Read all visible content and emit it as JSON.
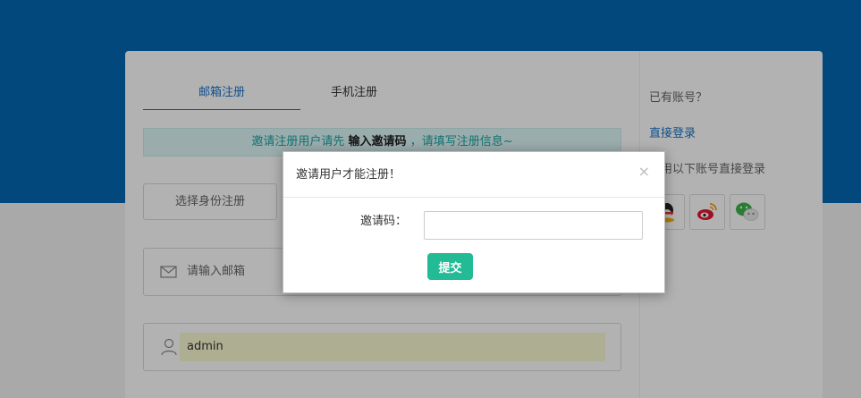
{
  "tabs": [
    {
      "label": "邮箱注册",
      "active": true
    },
    {
      "label": "手机注册",
      "active": false
    }
  ],
  "notice": {
    "prefix": "邀请注册用户请先",
    "highlight": "输入邀请码",
    "suffix": "，请填写注册信息~"
  },
  "form": {
    "identity_placeholder": "选择身份注册",
    "email_placeholder": "请输入邮箱",
    "username_value": "admin"
  },
  "sidebar": {
    "have_account": "已有账号？",
    "login_link": "直接登录",
    "third_party_text": "使用以下账号直接登录",
    "social": [
      {
        "icon": "qq-icon"
      },
      {
        "icon": "weibo-icon"
      },
      {
        "icon": "wechat-icon"
      }
    ]
  },
  "modal": {
    "title": "邀请用户才能注册！",
    "close": "×",
    "code_label": "邀请码：",
    "code_value": "",
    "submit_label": "提交"
  },
  "colors": {
    "header_blue": "#0567b3",
    "link_blue": "#1a73c8",
    "notice_teal": "#16a5a5",
    "submit_green": "#22bb95"
  }
}
